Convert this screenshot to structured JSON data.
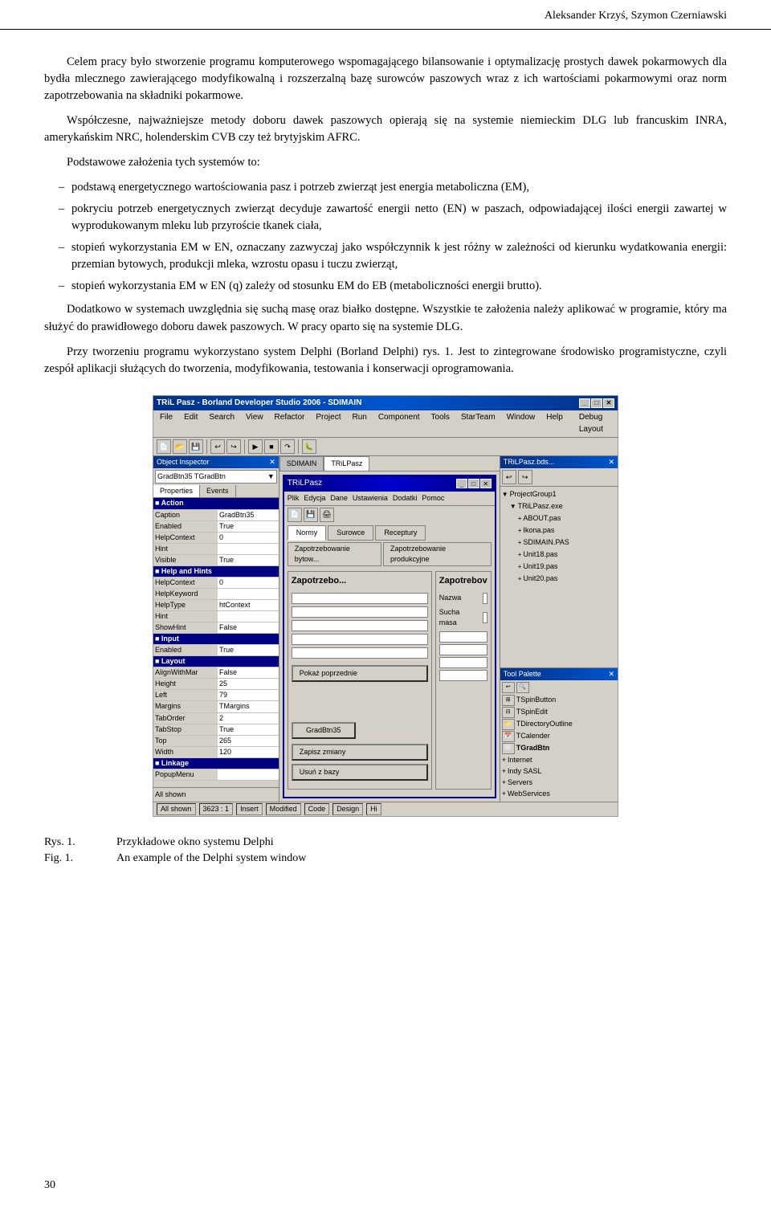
{
  "header": {
    "text": "Aleksander Krzyś, Szymon Czerniawski"
  },
  "paragraphs": {
    "p1": "Celem pracy było stworzenie programu komputerowego wspomagającego bilansowanie i optymalizację prostych dawek pokarmowych dla bydła mlecznego zawierającego modyfikowalną i rozszerzalną bazę surowców paszowych wraz z ich wartościami pokarmowymi oraz norm zapotrzebowania na składniki pokarmowe.",
    "p2": "Współczesne, najważniejsze metody doboru dawek paszowych opierają się na systemie niemieckim DLG lub francuskim  INRA, amerykańskim NRC, holenderskim CVB czy też brytyjskim AFRC.",
    "p3_intro": "Podstawowe założenia tych systemów to:",
    "bullets": [
      "podstawą energetycznego wartościowania pasz i potrzeb zwierząt jest energia metaboliczna (EM),",
      "pokryciu potrzeb energetycznych zwierząt decyduje zawartość energii netto (EN) w paszach, odpowiadającej ilości energii zawartej  w wyprodukowanym mleku lub przyroście tkanek ciała,",
      "stopień wykorzystania EM w EN, oznaczany zazwyczaj jako współczynnik k jest różny w zależności od kierunku wydatkowania energii: przemian bytowych, produkcji mleka, wzrostu opasu i tuczu zwierząt,",
      "stopień wykorzystania EM w EN (q) zależy od stosunku EM do EB (metaboliczności energii brutto)."
    ],
    "p4": "Dodatkowo w systemach uwzględnia się suchą masę oraz białko dostępne. Wszystkie te założenia należy aplikować w programie, który ma służyć do prawidłowego doboru dawek paszowych. W pracy oparto się na systemie DLG.",
    "p5": "Przy tworzeniu programu wykorzystano system Delphi (Borland Delphi) rys. 1. Jest to zintegrowane środowisko programistyczne, czyli zespół aplikacji służących do tworzenia, modyfikowania, testowania i konserwacji oprogramowania."
  },
  "screenshot": {
    "title": "TRiL Pasz - Borland Developer Studio 2006 - SDIMAIN",
    "menu_items": [
      "File",
      "Edit",
      "Search",
      "View",
      "Refactor",
      "Project",
      "Run",
      "Component",
      "Tools",
      "StarTeam",
      "Window",
      "Help",
      "Debug Layout"
    ],
    "obj_inspector": {
      "title": "Object Inspector",
      "selected": "GradBtn35 TGradBtn",
      "tabs": [
        "Properties",
        "Events"
      ],
      "sections": {
        "action": {
          "header": "Action",
          "props": [
            [
              "Caption",
              "GradBtn35"
            ],
            [
              "Enabled",
              "True"
            ],
            [
              "HelpContext",
              "0"
            ],
            [
              "Hint",
              ""
            ],
            [
              "Visible",
              "True"
            ]
          ]
        },
        "help_hints": {
          "header": "Help and Hints",
          "props": [
            [
              "HelpContext",
              "0"
            ],
            [
              "HelpKeyword",
              ""
            ],
            [
              "HelpType",
              "htContext"
            ],
            [
              "Hint",
              ""
            ],
            [
              "ShowHint",
              "False"
            ]
          ]
        },
        "input": {
          "header": "Input",
          "props": [
            [
              "Enabled",
              "True"
            ]
          ]
        },
        "layout": {
          "header": "Layout",
          "props": [
            [
              "AlignWithMar",
              "False"
            ],
            [
              "Height",
              "25"
            ],
            [
              "Left",
              "79"
            ],
            [
              "Margins",
              "TMargins"
            ],
            [
              "TabOrder",
              "2"
            ],
            [
              "TabStop",
              "True"
            ],
            [
              "Top",
              "265"
            ],
            [
              "Width",
              "120"
            ]
          ]
        },
        "linkage": {
          "header": "Linkage",
          "props": [
            [
              "PopupMenu",
              ""
            ]
          ]
        }
      }
    },
    "editor_tabs": [
      "SDIMAIN",
      "TRiLPasz"
    ],
    "tril_window": {
      "title": "TRiLPasz",
      "menu_items": [
        "Plik",
        "Edycja",
        "Dane",
        "Ustawienia",
        "Dodatki",
        "Pomoc"
      ],
      "tabs": [
        "Normy",
        "Surowce",
        "Receptury"
      ],
      "subtabs": [
        "Zapotrzebowanie bytow...",
        "Zapotrzebowanie produkcyjne"
      ],
      "inner_title": "Zapotrzebo...",
      "inner_title2": "Zapotrebov",
      "show_prev_btn": "Pokaż poprzednie",
      "grad_btn": "GradBtn35",
      "save_btn": "Zapisz zmiany",
      "delete_btn": "Usuń z bazy",
      "nazwa_label": "Nazwa",
      "sucha_label": "Sucha masa"
    },
    "file_panel": {
      "title": "TRiLPasz.bds...",
      "nodes": [
        {
          "label": "ProjectGroup1",
          "indent": 0,
          "expand": true
        },
        {
          "label": "TRiLPasz.exe",
          "indent": 1,
          "expand": true
        },
        {
          "label": "ABOUT.pas",
          "indent": 2,
          "expand": false
        },
        {
          "label": "Ikona.pas",
          "indent": 2,
          "expand": false
        },
        {
          "label": "SDIMAIN.PAS",
          "indent": 2,
          "expand": false
        },
        {
          "label": "Unit18.pas",
          "indent": 2,
          "expand": false
        },
        {
          "label": "Unit19.pas",
          "indent": 2,
          "expand": false
        },
        {
          "label": "Unit20.pas",
          "indent": 2,
          "expand": false
        }
      ]
    },
    "tool_palette": {
      "title": "Tool Palette",
      "tools": [
        "TSpinButton",
        "TSpinEdit",
        "TDirectoryOutline",
        "TCalender",
        "TGradBtn",
        "+ Internet",
        "+ Indy SASL",
        "+ Servers",
        "+ WebServices"
      ]
    },
    "status_bar": {
      "items": [
        "All shown",
        "3623 : 1",
        "Insert",
        "Modified",
        "Code",
        "Design",
        "Hi"
      ]
    }
  },
  "figure_caption": {
    "fig_rys_label": "Rys. 1.",
    "fig_rys_text": "Przykładowe okno systemu Delphi",
    "fig_fig_label": "Fig. 1.",
    "fig_fig_text": "An example of the Delphi system window"
  },
  "page_number": "30"
}
